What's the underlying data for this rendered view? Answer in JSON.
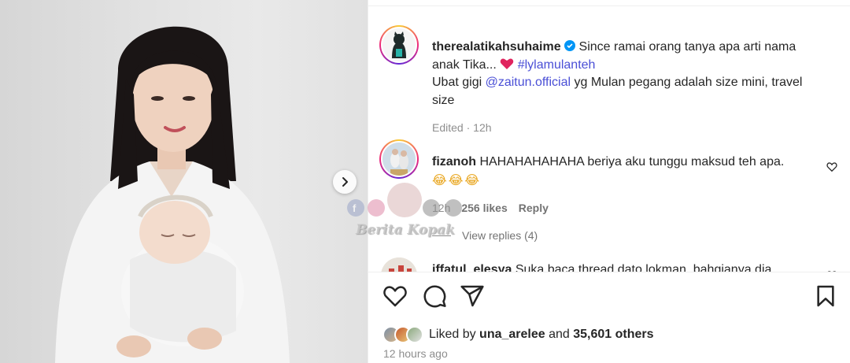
{
  "post": {
    "author": "therealatikahsuhaime",
    "verified": true,
    "caption_line1": " Since ramai orang tanya apa arti nama anak Tika... ",
    "caption_hashtag": "#lylamulanteh",
    "caption_line2a": "Ubat gigi ",
    "caption_mention": "@zaitun.official",
    "caption_line2b": " yg Mulan pegang adalah size mini, travel size",
    "edited_label": "Edited",
    "edited_time": "12h"
  },
  "comments": [
    {
      "username": "fizanoh",
      "text": " HAHAHAHAHAHA beriya aku tunggu maksud teh apa.",
      "emoji": "😂😂😂",
      "time": "12h",
      "likes": "256 likes",
      "reply_label": "Reply",
      "view_replies": "View replies (4)"
    },
    {
      "username": "iffatul_elesya",
      "text": " Suka baca thread dato lokman, bahgianya dia"
    }
  ],
  "likes": {
    "prefix": "Liked by ",
    "user": "una_arelee",
    "middle": " and ",
    "others": "35,601 others"
  },
  "timestamp": "12 hours ago",
  "watermark": "Berita Kopak",
  "icons": {
    "like": "heart-icon",
    "comment": "comment-icon",
    "share": "send-icon",
    "save": "bookmark-icon",
    "next": "chevron-right-icon",
    "verified": "verified-badge-icon"
  },
  "colors": {
    "link": "#00376b",
    "hashtag": "#4a4fd6",
    "verified": "#0095f6",
    "heart_emoji": "#e0245e",
    "muted": "#8e8e8e"
  }
}
